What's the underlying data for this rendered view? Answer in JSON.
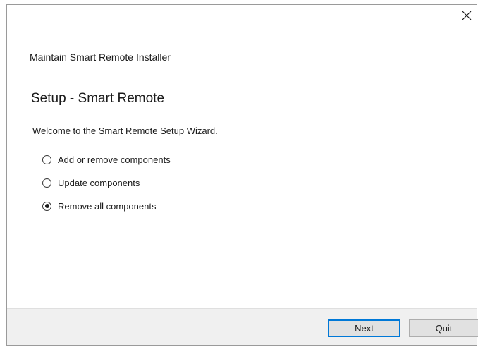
{
  "dialog": {
    "window_title": "Maintain Smart Remote Installer",
    "page_title": "Setup - Smart Remote",
    "welcome_text": "Welcome to the Smart Remote Setup Wizard.",
    "close_icon": "close-icon"
  },
  "options": [
    {
      "label": "Add or remove components",
      "checked": false
    },
    {
      "label": "Update components",
      "checked": false
    },
    {
      "label": "Remove all components",
      "checked": true
    }
  ],
  "footer": {
    "next_label": "Next",
    "quit_label": "Quit"
  },
  "colors": {
    "accent": "#0078d7",
    "footer_bg": "#f0f0f0"
  }
}
